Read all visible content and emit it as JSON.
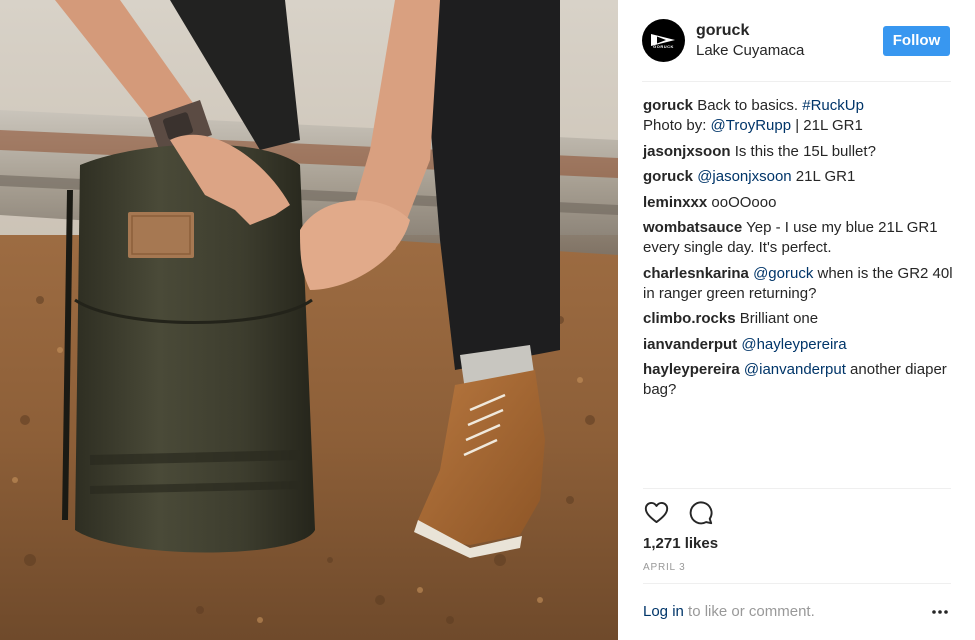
{
  "post": {
    "username": "goruck",
    "location": "Lake Cuyamaca",
    "avatar_word": "GORUCK",
    "follow_label": "Follow"
  },
  "comments": [
    {
      "author": "goruck",
      "text": "Back to basics. ",
      "link": "#RuckUp",
      "after_link": "",
      "line2": {
        "prefix": "Photo by: ",
        "link": "@TroyRupp",
        "after": " | 21L GR1"
      }
    },
    {
      "author": "jasonjxsoon",
      "text": "Is this the 15L bullet?"
    },
    {
      "author": "goruck",
      "link": "@jasonjxsoon",
      "text": " 21L GR1"
    },
    {
      "author": "leminxxx",
      "text": "ooOOooo"
    },
    {
      "author": "wombatsauce",
      "text": "Yep - I use my blue 21L GR1 every single day. It's perfect."
    },
    {
      "author": "charlesnkarina",
      "link": "@goruck",
      "text": " when is the GR2 40l in ranger green returning?"
    },
    {
      "author": "climbo.rocks",
      "text": "Brilliant one"
    },
    {
      "author": "ianvanderput",
      "link": "@hayleypereira",
      "text": ""
    },
    {
      "author": "hayleypereira",
      "link": "@ianvanderput",
      "text": " another diaper bag?"
    }
  ],
  "actions": {
    "like_icon": "heart-outline-icon",
    "comment_icon": "speech-bubble-icon"
  },
  "likes": "1,271 likes",
  "date": "APRIL 3",
  "footer": {
    "login_label": "Log in",
    "login_suffix": " to like or comment.",
    "more_icon": "ellipsis-icon"
  },
  "colors": {
    "follow_button": "#3897f0",
    "link": "#003569",
    "muted": "#999999",
    "text": "#262626"
  }
}
